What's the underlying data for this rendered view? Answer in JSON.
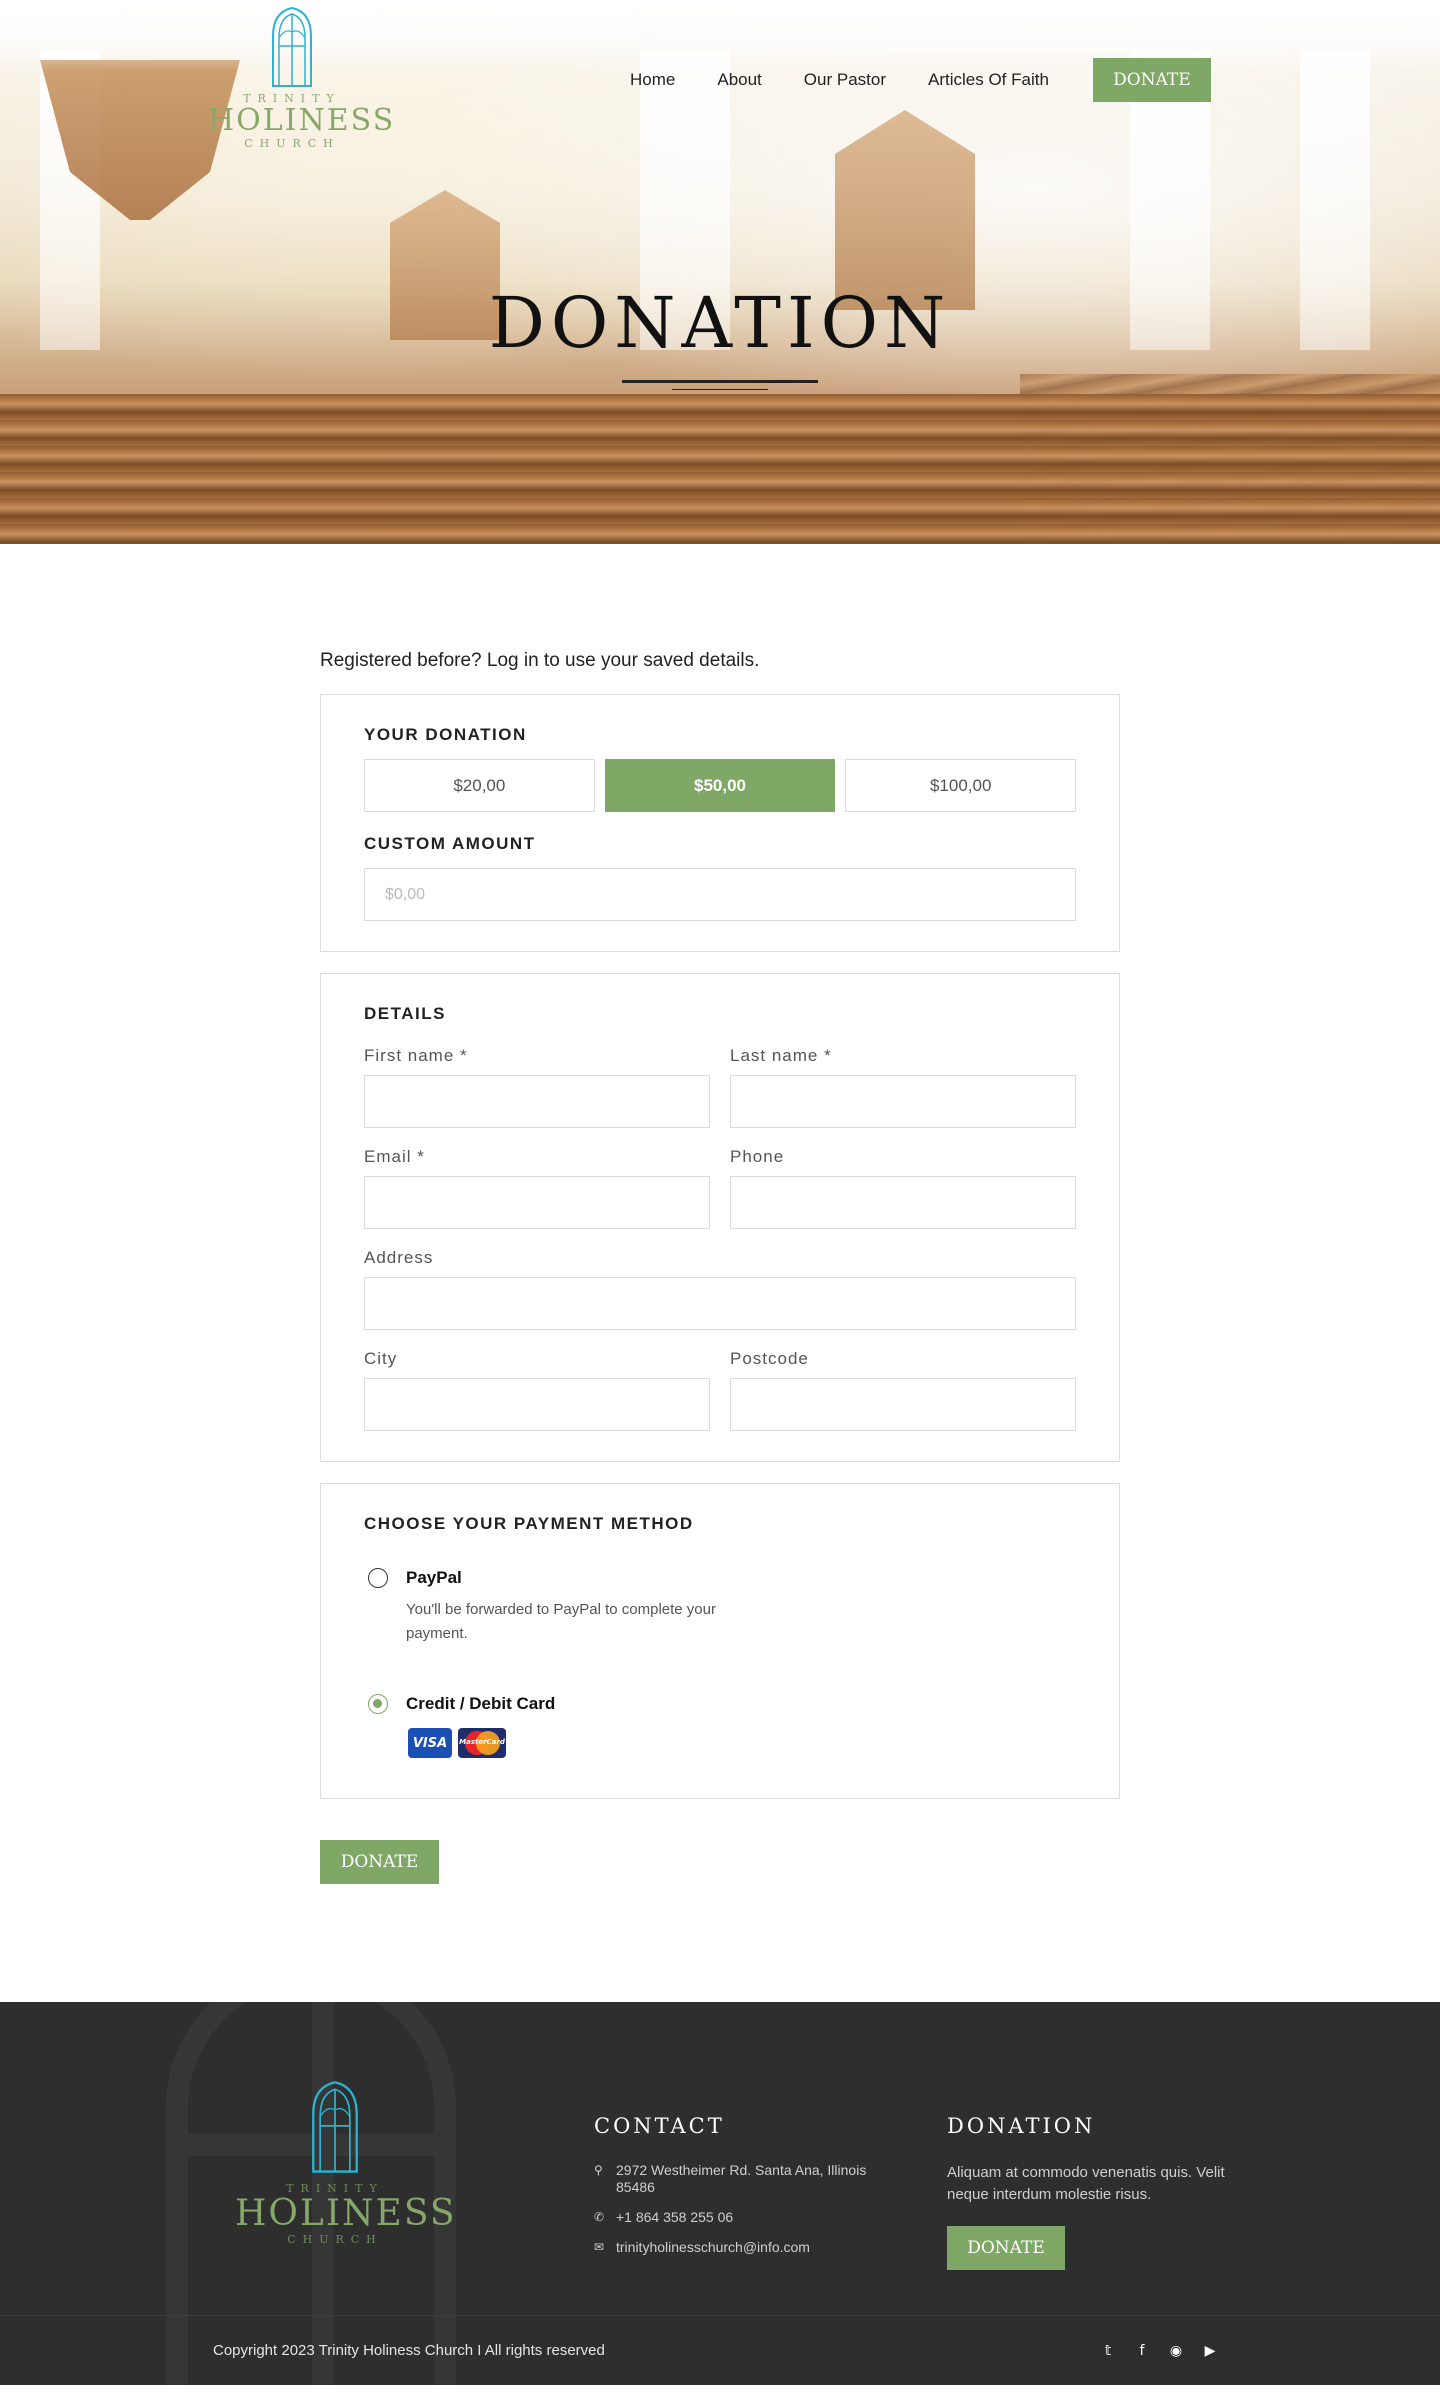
{
  "header": {
    "logo": {
      "top": "TRINITY",
      "main": "HOLINESS",
      "bottom": "CHURCH"
    },
    "nav": [
      {
        "label": "Home"
      },
      {
        "label": "About"
      },
      {
        "label": "Our Pastor"
      },
      {
        "label": "Articles Of Faith"
      }
    ],
    "donate_label": "DONATE"
  },
  "hero": {
    "title": "DONATION"
  },
  "form": {
    "login_note": "Registered before? Log in to use your saved details.",
    "donation": {
      "title": "YOUR DONATION",
      "amounts": [
        "$20,00",
        "$50,00",
        "$100,00"
      ],
      "selected_amount": "$50,00",
      "custom_title": "CUSTOM AMOUNT",
      "custom_placeholder": "$0,00"
    },
    "details": {
      "title": "DETAILS",
      "first_name_label": "First name *",
      "last_name_label": "Last name *",
      "email_label": "Email *",
      "phone_label": "Phone",
      "address_label": "Address",
      "city_label": "City",
      "postcode_label": "Postcode"
    },
    "payment": {
      "title": "CHOOSE YOUR PAYMENT METHOD",
      "paypal_label": "PayPal",
      "paypal_desc": "You'll be forwarded to PayPal to complete your payment.",
      "card_label": "Credit / Debit Card",
      "selected": "card",
      "visa_text": "VISA",
      "mastercard_text": "MasterCard"
    },
    "submit_label": "DONATE"
  },
  "footer": {
    "logo": {
      "top": "TRINITY",
      "main": "HOLINESS",
      "bottom": "CHURCH"
    },
    "contact": {
      "title": "CONTACT",
      "address": "2972 Westheimer Rd. Santa Ana, Illinois 85486",
      "phone": "+1 864 358 255 06",
      "email": "trinityholinesschurch@info.com"
    },
    "donation": {
      "title": "DONATION",
      "text": "Aliquam at commodo venenatis quis. Velit neque interdum molestie risus.",
      "button_label": "DONATE"
    },
    "copyright": "Copyright 2023 Trinity Holiness Church I All rights reserved",
    "socials": [
      "twitter-icon",
      "facebook-icon",
      "instagram-icon",
      "youtube-icon"
    ]
  },
  "colors": {
    "accent_green": "#7fa766",
    "logo_blue": "#2bb3cf",
    "footer_bg": "#2e2e2e"
  }
}
